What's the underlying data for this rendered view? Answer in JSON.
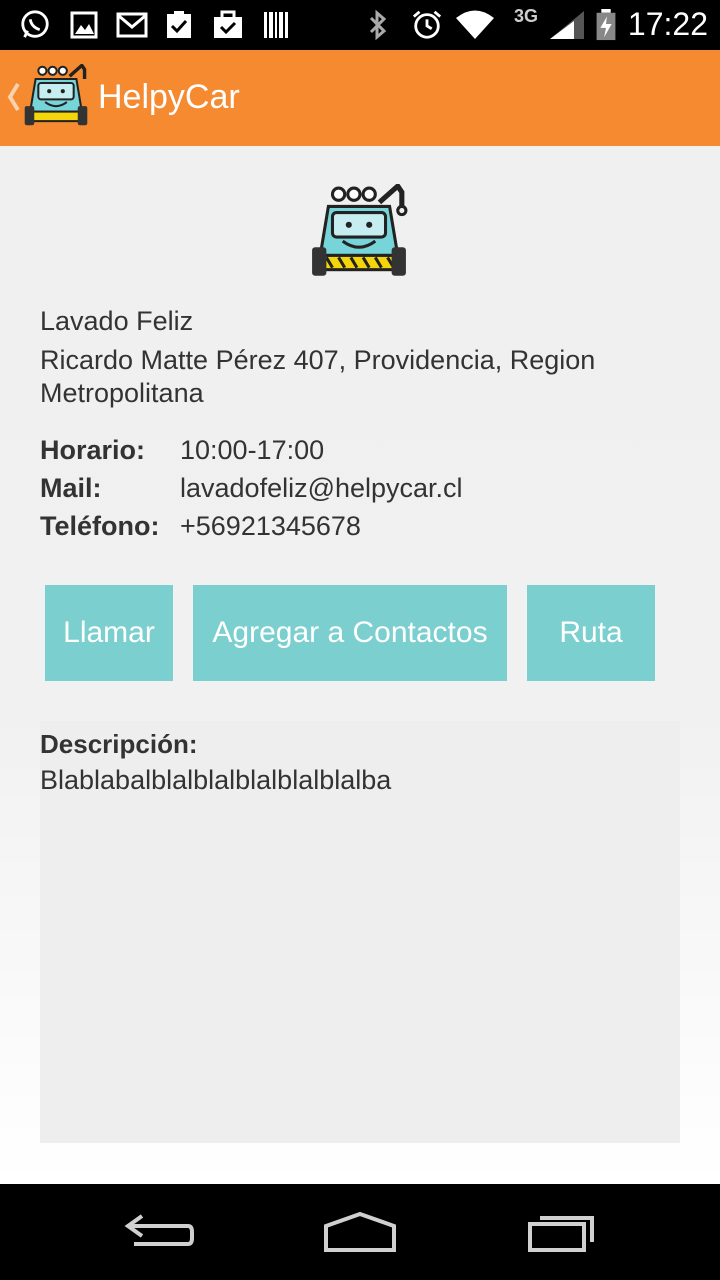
{
  "status_bar": {
    "time": "17:22",
    "network": "3G",
    "icons": [
      "whatsapp-icon",
      "gallery-icon",
      "gmail-icon",
      "task-check-icon",
      "briefcase-check-icon",
      "barcode-icon",
      "bluetooth-icon",
      "alarm-icon",
      "wifi-icon",
      "signal-icon",
      "battery-icon"
    ]
  },
  "action_bar": {
    "title": "HelpyCar",
    "icons": [
      "up-arrow-icon",
      "tow-truck-logo-icon"
    ]
  },
  "business": {
    "name": "Lavado Feliz",
    "address": "Ricardo Matte Pérez 407, Providencia, Region Metropolitana",
    "horario_label": "Horario:",
    "horario_value": "10:00-17:00",
    "mail_label": "Mail:",
    "mail_value": "lavadofeliz@helpycar.cl",
    "telefono_label": "Teléfono:",
    "telefono_value": "+56921345678"
  },
  "buttons": {
    "call": "Llamar",
    "add_contacts": "Agregar a Contactos",
    "route": "Ruta"
  },
  "description": {
    "label": "Descripción:",
    "text": "Blablabalblalblalblalblalblalba"
  },
  "colors": {
    "action_bar": "#f58a30",
    "button": "#7ccfcf",
    "description_bg": "#eeeeee"
  },
  "nav_bar": {
    "icons": [
      "back-icon",
      "home-icon",
      "recents-icon"
    ]
  }
}
